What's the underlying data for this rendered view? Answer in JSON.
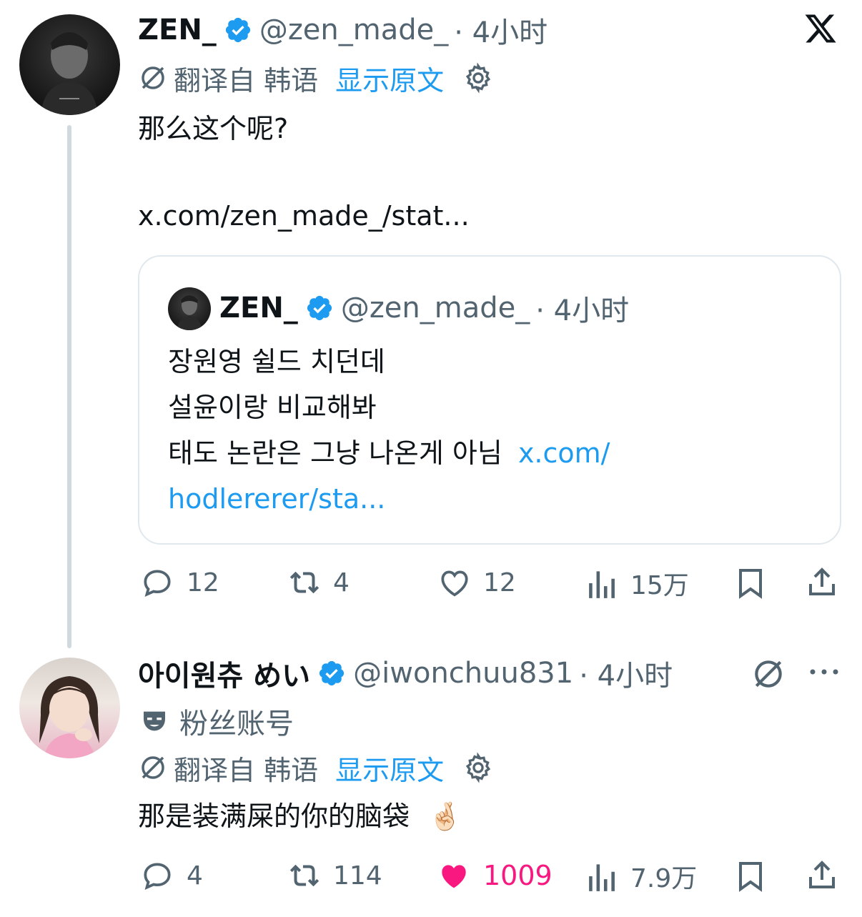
{
  "tweet1": {
    "name": "ZEN_",
    "handle": "@zen_made_",
    "time": "· 4小时",
    "translated_from": "翻译自 韩语",
    "show_original": "显示原文",
    "text": "那么这个呢?",
    "link": "x.com/zen_made_/stat...",
    "quote": {
      "name": "ZEN_",
      "handle": "@zen_made_",
      "time": "· 4小时",
      "line1": "장원영 쉴드 치던데",
      "line2": "설윤이랑 비교해봐",
      "line3": "태도 논란은 그냥 나온게 아님",
      "link_part1": "x.com/",
      "link_part2": "hodlererer/sta..."
    },
    "actions": {
      "replies": "12",
      "retweets": "4",
      "likes": "12",
      "views": "15万"
    }
  },
  "tweet2": {
    "name": "아이원츄 めい",
    "handle": "@iwonchuu831",
    "time": "· 4小时",
    "fan_label": "粉丝账号",
    "translated_from": "翻译自 韩语",
    "show_original": "显示原文",
    "text": "那是装满屎的你的脑袋",
    "emoji": "🤞🏻",
    "actions": {
      "replies": "4",
      "retweets": "114",
      "likes": "1009",
      "views": "7.9万"
    }
  },
  "colors": {
    "link_blue": "#1d9bf0",
    "like_pink": "#f91880",
    "muted": "#536471",
    "border": "#e1e8ed"
  },
  "icons": [
    "x-logo-icon",
    "verified-badge-icon",
    "translate-icon",
    "gear-icon",
    "reply-icon",
    "retweet-icon",
    "like-icon",
    "views-icon",
    "bookmark-icon",
    "share-icon",
    "more-icon",
    "fan-mask-icon"
  ]
}
